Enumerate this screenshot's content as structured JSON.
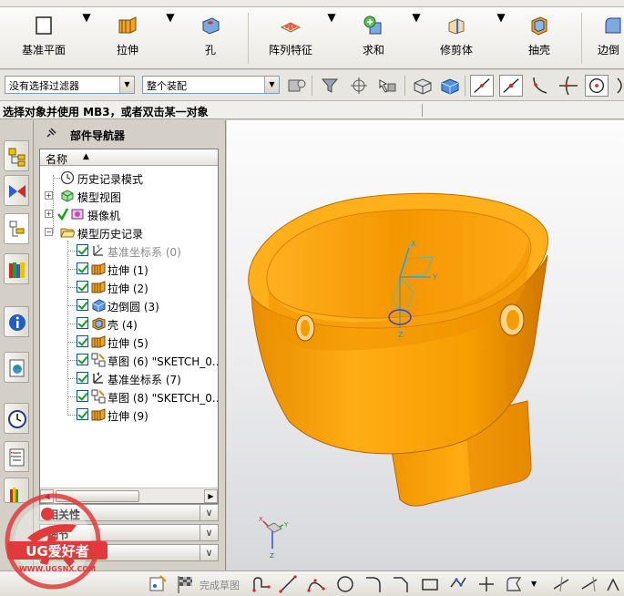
{
  "ribbon": {
    "datum_plane": "基准平面",
    "extrude": "拉伸",
    "hole": "孔",
    "pattern_feature": "阵列特征",
    "unite": "求和",
    "trim_body": "修剪体",
    "shell": "抽壳",
    "edge_blend": "边倒"
  },
  "selection_bar": {
    "filter": "没有选择过滤器",
    "scope": "整个装配"
  },
  "cue_line": "选择对象并使用 MB3，或者双击某一对象",
  "navigator": {
    "title": "部件导航器",
    "column_name": "名称",
    "nodes": [
      {
        "label": "历史记录模式"
      },
      {
        "label": "模型视图"
      },
      {
        "label": "摄像机"
      },
      {
        "label": "模型历史记录"
      }
    ],
    "features": [
      {
        "label": "基准坐标系 (0)",
        "dim": true
      },
      {
        "label": "拉伸 (1)"
      },
      {
        "label": "拉伸 (2)"
      },
      {
        "label": "边倒圆 (3)"
      },
      {
        "label": "壳 (4)"
      },
      {
        "label": "拉伸 (5)"
      },
      {
        "label": "草图 (6) \"SKETCH_0..."
      },
      {
        "label": "基准坐标系 (7)"
      },
      {
        "label": "草图 (8) \"SKETCH_0..."
      },
      {
        "label": "拉伸 (9)"
      }
    ],
    "panels": [
      "相关性",
      "细节",
      "预览"
    ]
  },
  "bottom_toolbar": {
    "finish_sketch": "完成草图"
  },
  "watermark": {
    "brand": "UG爱好者",
    "url": "WWW.UGSNX.COM"
  },
  "colors": {
    "model_orange": "#f5a000",
    "accent_blue": "#1c5180"
  }
}
